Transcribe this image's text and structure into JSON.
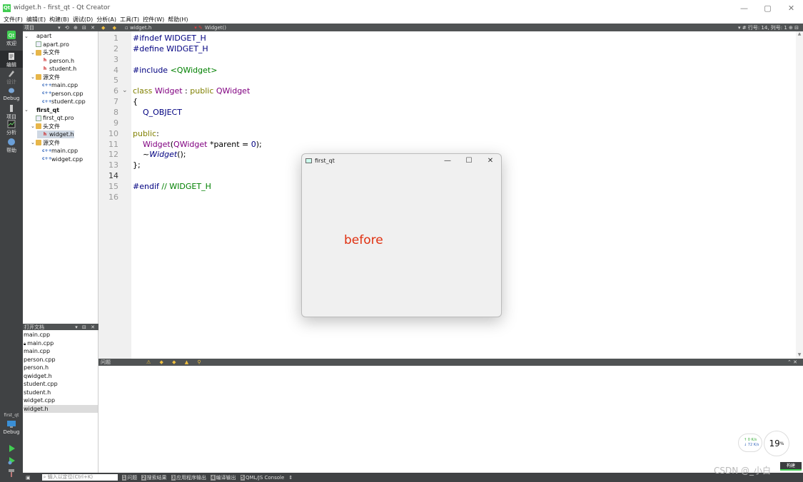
{
  "window": {
    "title": "widget.h - first_qt - Qt Creator",
    "app_icon": "qt-icon",
    "controls": [
      "—",
      "▢",
      "✕"
    ]
  },
  "menu": [
    "文件(F)",
    "编辑(E)",
    "构建(B)",
    "调试(D)",
    "分析(A)",
    "工具(T)",
    "控件(W)",
    "帮助(H)"
  ],
  "modes": [
    {
      "label": "欢迎",
      "icon": "qt-logo-icon"
    },
    {
      "label": "编辑",
      "icon": "edit-icon"
    },
    {
      "label": "设计",
      "icon": "design-icon"
    },
    {
      "label": "Debug",
      "icon": "debug-icon"
    },
    {
      "label": "项目",
      "icon": "wrench-icon"
    },
    {
      "label": "分析",
      "icon": "analyze-icon"
    },
    {
      "label": "帮助",
      "icon": "help-icon"
    }
  ],
  "kit": {
    "project": "first_qt",
    "config": "Debug"
  },
  "project_pane": {
    "header": "项目",
    "tree": [
      {
        "label": "apart",
        "level": 0,
        "kind": "project",
        "expanded": true
      },
      {
        "label": "apart.pro",
        "level": 1,
        "kind": "pro"
      },
      {
        "label": "头文件",
        "level": 1,
        "kind": "folder",
        "expanded": true
      },
      {
        "label": "person.h",
        "level": 2,
        "kind": "h"
      },
      {
        "label": "student.h",
        "level": 2,
        "kind": "h"
      },
      {
        "label": "源文件",
        "level": 1,
        "kind": "folder",
        "expanded": true
      },
      {
        "label": "main.cpp",
        "level": 2,
        "kind": "cpp"
      },
      {
        "label": "person.cpp",
        "level": 2,
        "kind": "cpp"
      },
      {
        "label": "student.cpp",
        "level": 2,
        "kind": "cpp"
      },
      {
        "label": "first_qt",
        "level": 0,
        "kind": "project",
        "expanded": true,
        "bold": true
      },
      {
        "label": "first_qt.pro",
        "level": 1,
        "kind": "pro"
      },
      {
        "label": "头文件",
        "level": 1,
        "kind": "folder",
        "expanded": true
      },
      {
        "label": "widget.h",
        "level": 2,
        "kind": "h",
        "selected": true
      },
      {
        "label": "源文件",
        "level": 1,
        "kind": "folder",
        "expanded": true
      },
      {
        "label": "main.cpp",
        "level": 2,
        "kind": "cpp"
      },
      {
        "label": "widget.cpp",
        "level": 2,
        "kind": "cpp"
      }
    ]
  },
  "open_docs": {
    "header": "打开文档",
    "items": [
      "main.cpp",
      "main.cpp",
      "main.cpp",
      "person.cpp",
      "person.h",
      "qwidget.h",
      "student.cpp",
      "student.h",
      "widget.cpp",
      "widget.h"
    ],
    "locked_index": 1,
    "selected_index": 9
  },
  "editor": {
    "file": "widget.h",
    "symbol": "Widget()",
    "position": "行号: 14, 列号: 1",
    "current_line": 14,
    "fold_line": 6,
    "lines": [
      [
        {
          "t": "#ifndef WIDGET_H",
          "c": "plain-blue"
        }
      ],
      [
        {
          "t": "#define WIDGET_H",
          "c": "plain-blue"
        }
      ],
      [],
      [
        {
          "t": "#include ",
          "c": "plain-blue"
        },
        {
          "t": "<QWidget>",
          "c": "inc"
        }
      ],
      [],
      [
        {
          "t": "class ",
          "c": "kw"
        },
        {
          "t": "Widget",
          "c": "ty"
        },
        {
          "t": " : ",
          "c": "plain"
        },
        {
          "t": "public ",
          "c": "kw"
        },
        {
          "t": "QWidget",
          "c": "ty"
        }
      ],
      [
        {
          "t": "{",
          "c": "plain"
        }
      ],
      [
        {
          "t": "    Q_OBJECT",
          "c": "plain-blue"
        }
      ],
      [],
      [
        {
          "t": "public",
          "c": "kw"
        },
        {
          "t": ":",
          "c": "plain"
        }
      ],
      [
        {
          "t": "    ",
          "c": "plain"
        },
        {
          "t": "Widget",
          "c": "ty"
        },
        {
          "t": "(",
          "c": "plain"
        },
        {
          "t": "QWidget",
          "c": "ty"
        },
        {
          "t": " *parent = ",
          "c": "plain"
        },
        {
          "t": "0",
          "c": "plain-blue"
        },
        {
          "t": ");",
          "c": "plain"
        }
      ],
      [
        {
          "t": "    ~",
          "c": "plain"
        },
        {
          "t": "Widget",
          "c": "it"
        },
        {
          "t": "();",
          "c": "plain"
        }
      ],
      [
        {
          "t": "};",
          "c": "plain"
        }
      ],
      [],
      [
        {
          "t": "#endif ",
          "c": "plain-blue"
        },
        {
          "t": "// WIDGET_H",
          "c": "cm"
        }
      ],
      []
    ]
  },
  "app_window": {
    "title": "first_qt",
    "label": "before",
    "label_color": "#e03010"
  },
  "output_pane": {
    "header": "问题"
  },
  "status": {
    "locator_placeholder": "输入以定位(Ctrl+K)",
    "tabs": [
      {
        "num": "1",
        "label": "问题"
      },
      {
        "num": "2",
        "label": "搜索结果"
      },
      {
        "num": "3",
        "label": "应用程序输出"
      },
      {
        "num": "4",
        "label": "编译输出"
      },
      {
        "num": "5",
        "label": "QML/JS Console"
      }
    ]
  },
  "overlay": {
    "net_up": "↑ 0  K/s",
    "net_down": "↓ 72  K/s",
    "gauge_value": "19",
    "gauge_unit": "%",
    "watermark": "CSDN @_小白",
    "build_label": "构建"
  }
}
